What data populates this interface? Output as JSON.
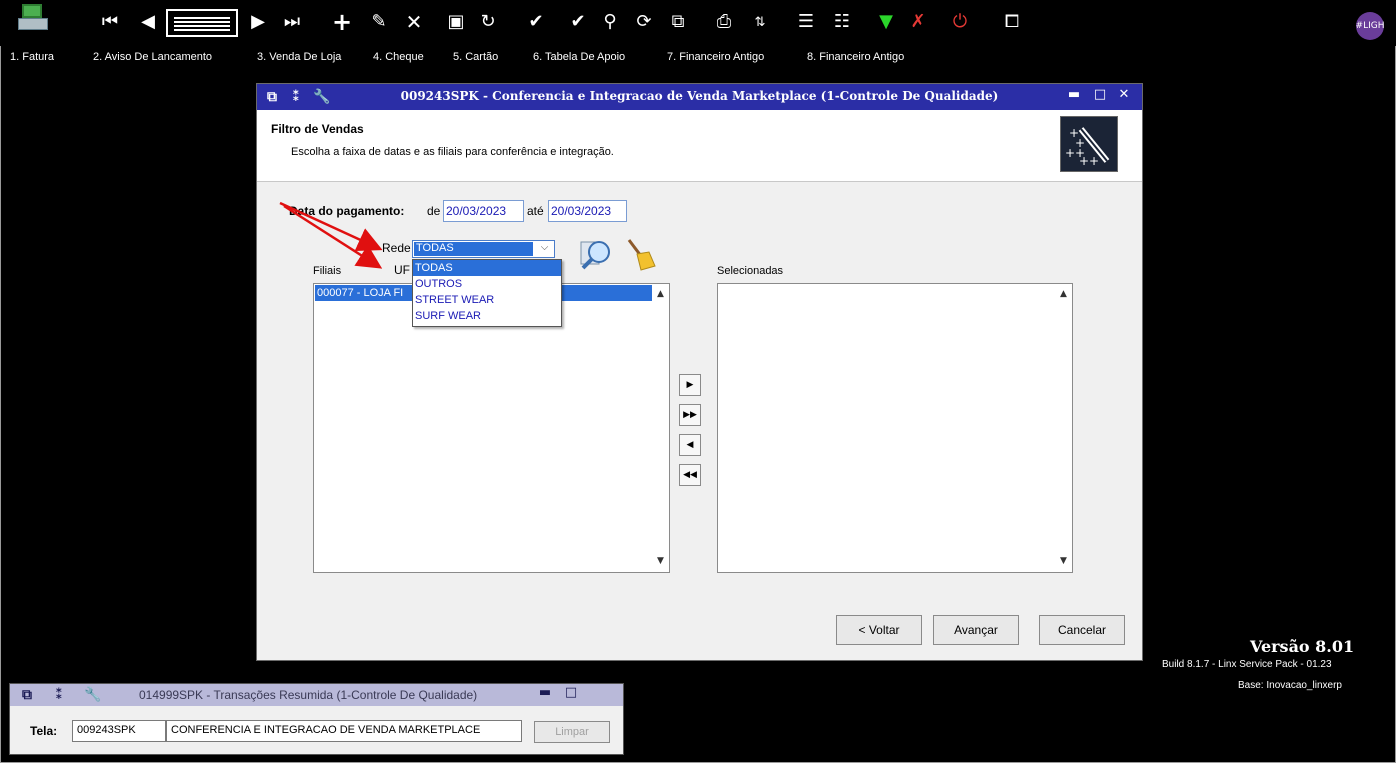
{
  "menu": {
    "items": [
      "1. Fatura",
      "2. Aviso De Lancamento",
      "3. Venda De Loja",
      "4. Cheque",
      "5. Cartão",
      "6. Tabela De Apoio",
      "7. Financeiro Antigo",
      "8. Financeiro Antigo"
    ]
  },
  "toolbar": {
    "avatar_label": "#LIGH",
    "icons": [
      "first-record-icon",
      "previous-record-icon",
      "grid-view-icon",
      "next-record-icon",
      "last-record-icon",
      "add-icon",
      "edit-icon",
      "delete-icon",
      "save-icon",
      "refresh-icon",
      "confirm-icon",
      "confirm-all-icon",
      "search-icon",
      "reload-icon",
      "preview-icon",
      "print-icon",
      "sort-icon",
      "export-icon",
      "report-icon",
      "download-icon",
      "cancel-icon",
      "stop-icon",
      "window-icon"
    ]
  },
  "dialog": {
    "title": "009243SPK - Conferencia e Integracao de Venda Marketplace (1-Controle De Qualidade)",
    "header_title": "Filtro de Vendas",
    "header_subtitle": "Escolha a faixa de datas e as filiais para conferência e integração.",
    "date_label": "Data do pagamento:",
    "from_label": "de",
    "from_value": "20/03/2023",
    "to_label": "até",
    "to_value": "20/03/2023",
    "rede_label": "Rede",
    "rede_value": "TODAS",
    "uf_label": "UF",
    "rede_options": [
      "TODAS",
      "OUTROS",
      "STREET WEAR",
      "SURF WEAR"
    ],
    "filiais_label": "Filiais",
    "filiais_items": [
      "000077 - LOJA FI"
    ],
    "selecionadas_label": "Selecionadas",
    "buttons": {
      "voltar": "< Voltar",
      "avancar": "Avançar",
      "cancelar": "Cancelar"
    }
  },
  "version": {
    "title": "Versão  8.01",
    "build": "Build 8.1.7 - Linx Service Pack - 01.23",
    "base": "Base: Inovacao_linxerp"
  },
  "window2": {
    "title": "014999SPK - Transações Resumida (1-Controle De Qualidade)",
    "tela_label": "Tela:",
    "tela_code": "009243SPK",
    "tela_desc": "CONFERENCIA E INTEGRACAO DE VENDA MARKETPLACE",
    "limpar": "Limpar"
  },
  "colors": {
    "title_bar": "#2b2ea6",
    "selection": "#2a6fd8",
    "arrow": "#e01010",
    "dropdown_text": "#1a1ab4"
  }
}
